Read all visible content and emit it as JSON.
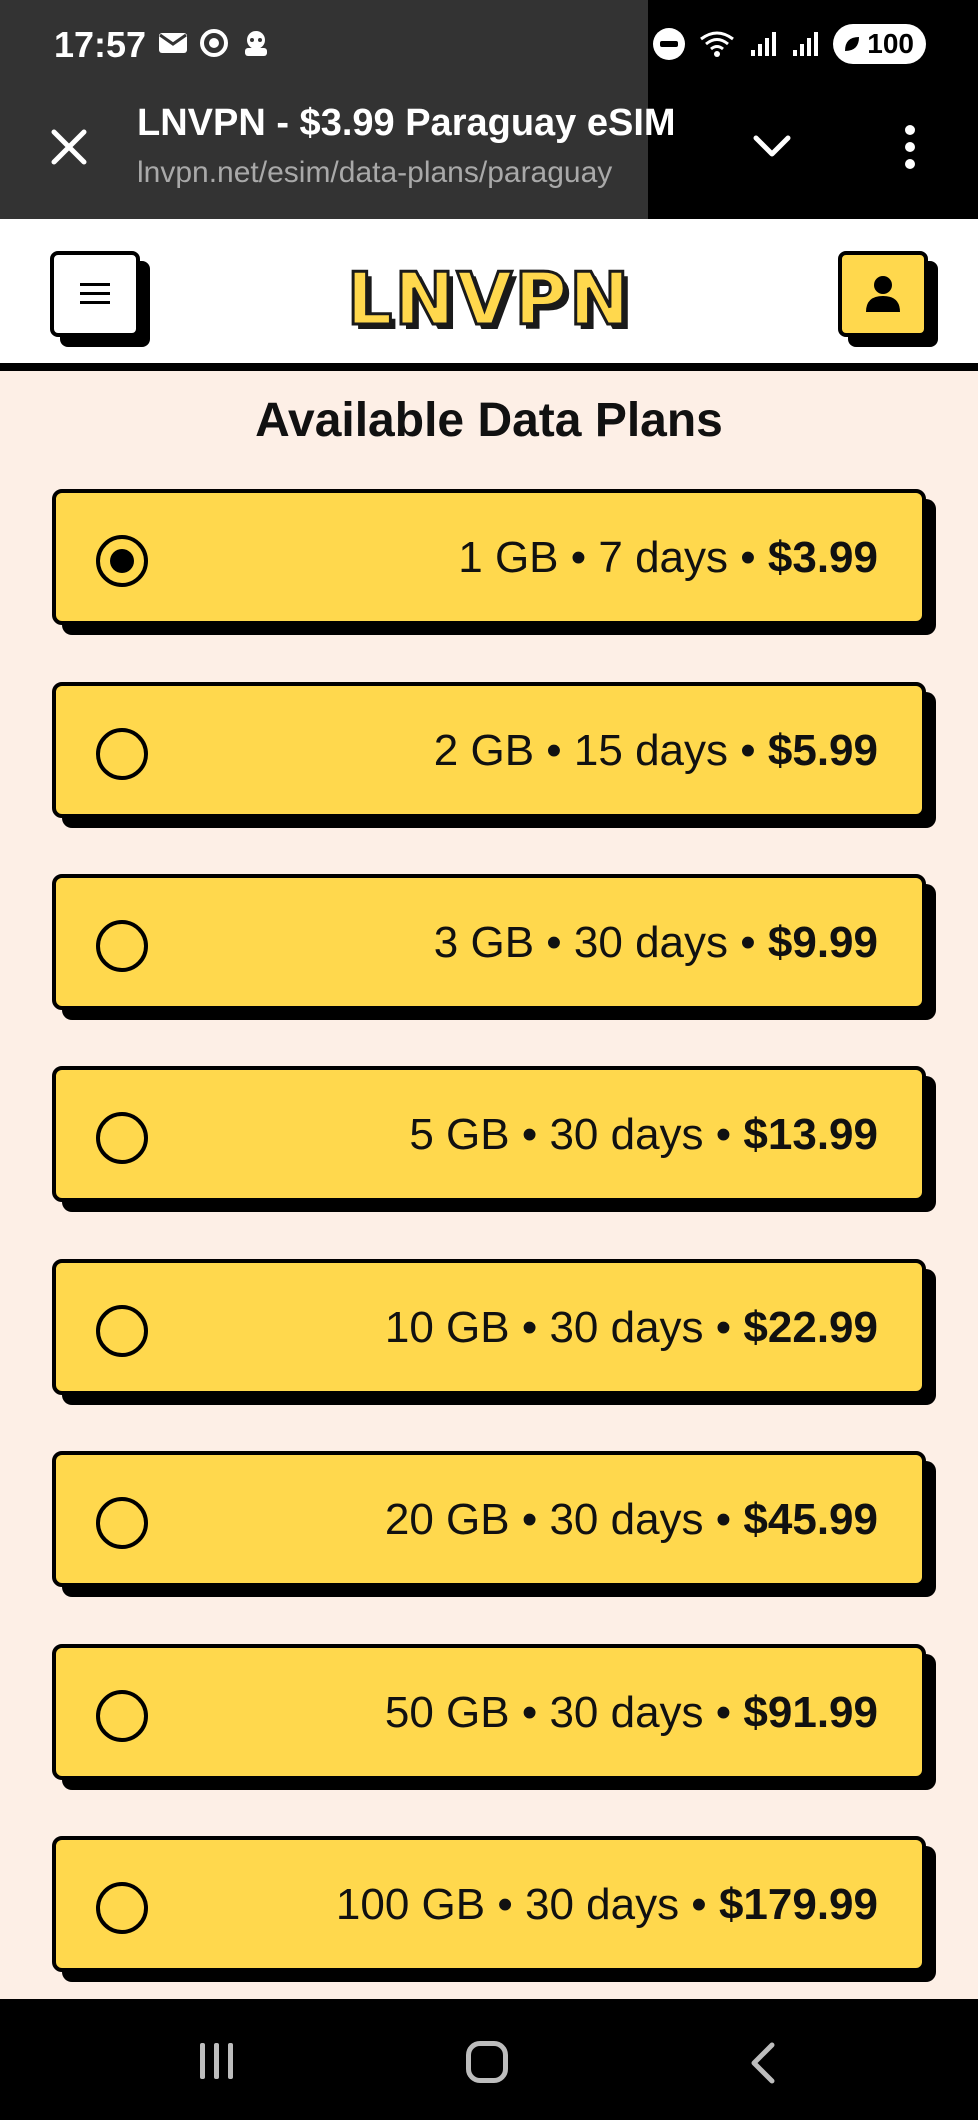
{
  "status_bar": {
    "time": "17:57",
    "left_icons": [
      "mail-icon",
      "chrome-icon",
      "app-icon"
    ],
    "right_icons": [
      "dnd-icon",
      "wifi-icon",
      "signal-icon",
      "signal-icon"
    ],
    "battery": "100"
  },
  "browser": {
    "tab_title": "LNVPN - $3.99 Paraguay eSIM",
    "url": "lnvpn.net/esim/data-plans/paraguay"
  },
  "site": {
    "logo": "LNVPN",
    "accent_color": "#ffd84d",
    "background_color": "#fdefe6"
  },
  "main": {
    "title": "Available Data Plans",
    "plans": [
      {
        "label": "1 GB • 7 days • ",
        "price": "$3.99",
        "selected": true
      },
      {
        "label": "2 GB • 15 days • ",
        "price": "$5.99",
        "selected": false
      },
      {
        "label": "3 GB • 30 days • ",
        "price": "$9.99",
        "selected": false
      },
      {
        "label": "5 GB • 30 days • ",
        "price": "$13.99",
        "selected": false
      },
      {
        "label": "10 GB • 30 days • ",
        "price": "$22.99",
        "selected": false
      },
      {
        "label": "20 GB • 30 days • ",
        "price": "$45.99",
        "selected": false
      },
      {
        "label": "50 GB • 30 days • ",
        "price": "$91.99",
        "selected": false
      },
      {
        "label": "100 GB • 30 days • ",
        "price": "$179.99",
        "selected": false
      }
    ]
  }
}
